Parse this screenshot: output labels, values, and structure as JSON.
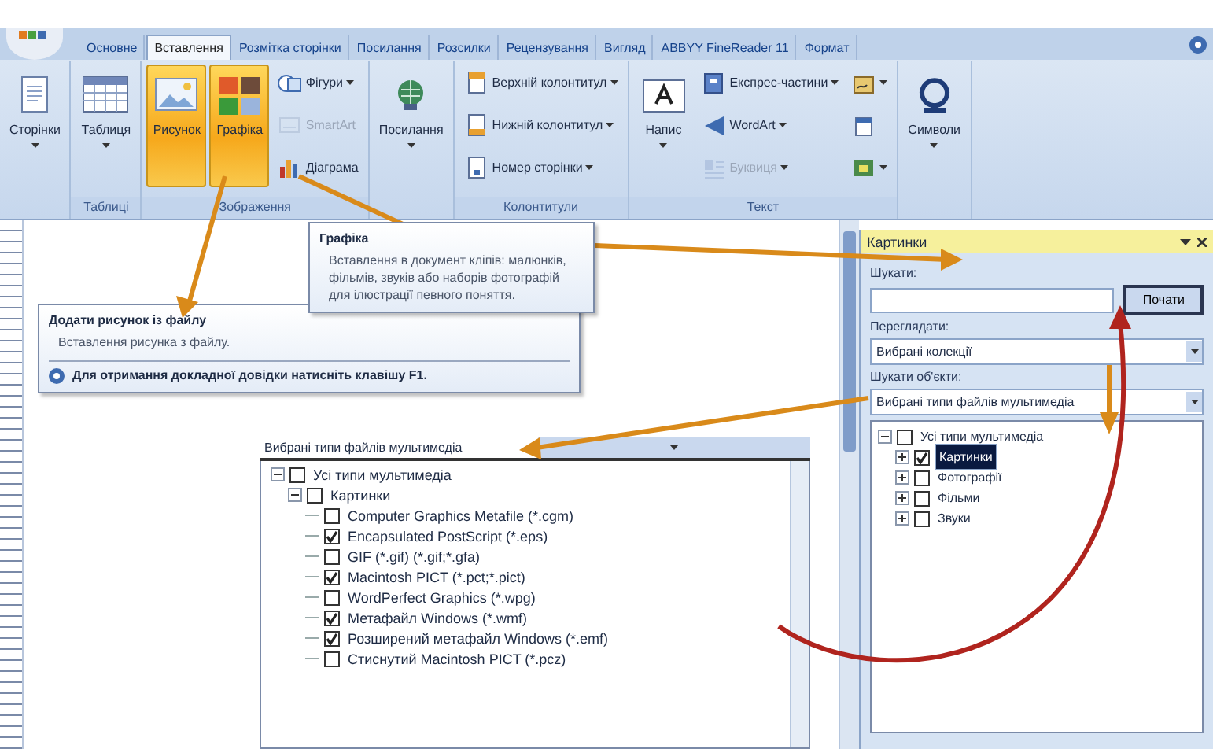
{
  "ribbon": {
    "tabs": [
      {
        "label": "Основне",
        "selected": false
      },
      {
        "label": "Вставлення",
        "selected": true
      },
      {
        "label": "Розмітка сторінки",
        "selected": false
      },
      {
        "label": "Посилання",
        "selected": false
      },
      {
        "label": "Розсилки",
        "selected": false
      },
      {
        "label": "Рецензування",
        "selected": false
      },
      {
        "label": "Вигляд",
        "selected": false
      },
      {
        "label": "ABBYY FineReader 11",
        "selected": false
      },
      {
        "label": "Формат",
        "selected": false
      }
    ],
    "groups": [
      {
        "controls": [
          {
            "kind": "large",
            "label": "Сторінки",
            "dropdown": true,
            "disabled": false,
            "active": false
          }
        ]
      },
      {
        "label": "Таблиці",
        "controls": [
          {
            "kind": "large",
            "label": "Таблиця",
            "dropdown": true,
            "disabled": false,
            "active": false
          }
        ]
      },
      {
        "label": "Зображення",
        "controls": [
          {
            "kind": "large",
            "label": "Рисунок",
            "dropdown": false,
            "disabled": false,
            "active": true
          },
          {
            "kind": "large",
            "label": "Графіка",
            "dropdown": false,
            "disabled": false,
            "active": true
          },
          {
            "kind": "small",
            "label": "Фігури",
            "dropdown": true,
            "disabled": false,
            "active": false
          },
          {
            "kind": "small",
            "label": "SmartArt",
            "dropdown": false,
            "disabled": true,
            "active": false
          },
          {
            "kind": "small",
            "label": "Діаграма",
            "dropdown": false,
            "disabled": false,
            "active": false
          }
        ]
      },
      {
        "controls": [
          {
            "kind": "large",
            "label": "Посилання",
            "dropdown": true,
            "disabled": false,
            "active": false
          }
        ]
      },
      {
        "label": "Колонтитули",
        "controls": [
          {
            "kind": "small",
            "label": "Верхній колонтитул",
            "dropdown": true,
            "disabled": false,
            "active": false
          },
          {
            "kind": "small",
            "label": "Нижній колонтитул",
            "dropdown": true,
            "disabled": false,
            "active": false
          },
          {
            "kind": "small",
            "label": "Номер сторінки",
            "dropdown": true,
            "disabled": false,
            "active": false
          }
        ]
      },
      {
        "label": "Текст",
        "controls": [
          {
            "kind": "large",
            "label": "Напис",
            "dropdown": true,
            "disabled": false,
            "active": false
          },
          {
            "kind": "small",
            "label": "Експрес-частини",
            "dropdown": true,
            "disabled": false,
            "active": false
          },
          {
            "kind": "small",
            "label": "WordArt",
            "dropdown": true,
            "disabled": false,
            "active": false
          },
          {
            "kind": "small",
            "label": "Буквиця",
            "dropdown": true,
            "disabled": true,
            "active": false
          },
          {
            "kind": "icon",
            "dropdown": true,
            "disabled": false,
            "active": false
          },
          {
            "kind": "icon",
            "dropdown": false,
            "disabled": false,
            "active": false
          },
          {
            "kind": "icon",
            "dropdown": true,
            "disabled": false,
            "active": false
          }
        ]
      },
      {
        "controls": [
          {
            "kind": "large",
            "label": "Символи",
            "dropdown": true,
            "disabled": false,
            "active": false
          }
        ]
      }
    ]
  },
  "tooltips": [
    {
      "title": "Графіка",
      "text": "Вставлення в документ кліпів: малюнків, фільмів, звуків або наборів фотографій для ілюстрації певного поняття."
    },
    {
      "title": "Додати рисунок із файлу",
      "text": "Вставлення рисунка з файлу.",
      "help": "Для отримання докладної довідки натисніть клавішу F1."
    }
  ],
  "file_types_dropdown": {
    "value": "Вибрані типи файлів мультимедіа",
    "tree": [
      {
        "label": "Усі типи мультимедіа",
        "checked": false,
        "expanded": true,
        "children": [
          {
            "label": "Картинки",
            "checked": false,
            "expanded": true,
            "children": [
              {
                "label": "Computer Graphics Metafile (*.cgm)",
                "checked": false
              },
              {
                "label": "Encapsulated PostScript (*.eps)",
                "checked": true
              },
              {
                "label": "GIF (*.gif) (*.gif;*.gfa)",
                "checked": false
              },
              {
                "label": "Macintosh PICT (*.pct;*.pict)",
                "checked": true
              },
              {
                "label": "WordPerfect Graphics (*.wpg)",
                "checked": false
              },
              {
                "label": "Метафайл Windows (*.wmf)",
                "checked": true
              },
              {
                "label": "Розширений метафайл Windows (*.emf)",
                "checked": true
              },
              {
                "label": "Стиснутий Macintosh PICT (*.pcz)",
                "checked": false
              }
            ]
          }
        ]
      }
    ]
  },
  "task_pane": {
    "title": "Картинки",
    "search_label": "Шукати:",
    "search_button": "Почати",
    "look_in_label": "Переглядати:",
    "look_in_value": "Вибрані колекції",
    "types_label": "Шукати об'єкти:",
    "types_value": "Вибрані типи файлів мультимедіа",
    "types_tree": [
      {
        "label": "Усі типи мультимедіа",
        "checked": false,
        "selected": false,
        "expanded": true,
        "children": [
          {
            "label": "Картинки",
            "checked": true,
            "selected": true,
            "expanded": false
          },
          {
            "label": "Фотографії",
            "checked": false,
            "selected": false,
            "expanded": false
          },
          {
            "label": "Фільми",
            "checked": false,
            "selected": false,
            "expanded": false
          },
          {
            "label": "Звуки",
            "checked": false,
            "selected": false,
            "expanded": false
          }
        ]
      }
    ]
  }
}
